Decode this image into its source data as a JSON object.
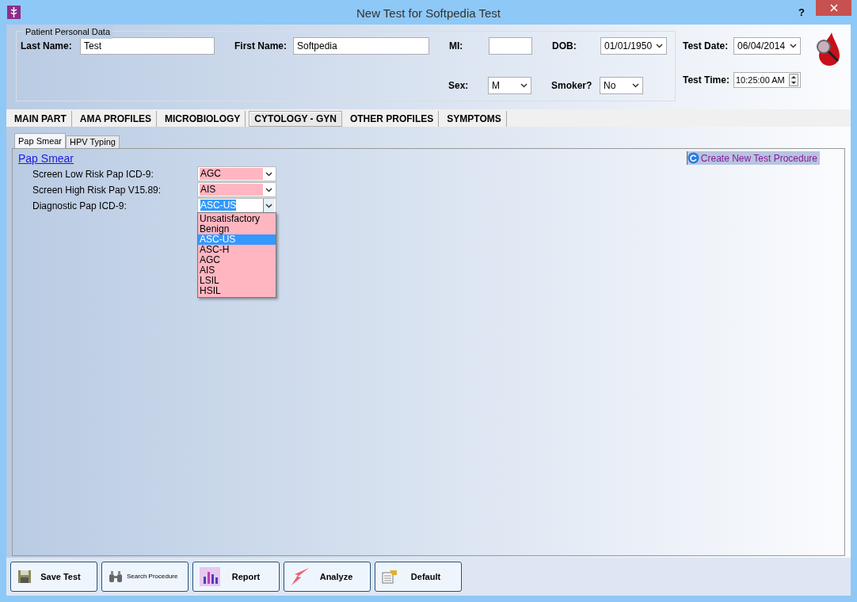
{
  "window": {
    "title": "New Test for Softpedia Test",
    "help": "?"
  },
  "patient": {
    "title": "Patient Personal Data",
    "row1": [
      {
        "label": "Last Name:",
        "value": "Test",
        "kind": "text"
      },
      {
        "label": "First Name:",
        "value": "Softpedia",
        "kind": "text"
      },
      {
        "label": "MI:",
        "kind": "text"
      },
      {
        "label": "DOB:",
        "value": "01/01/1950",
        "kind": "select"
      }
    ],
    "row2": [
      {
        "label": "Sex:",
        "value": "M",
        "kind": "select"
      },
      {
        "label": "Smoker?",
        "value": "No",
        "kind": "select"
      }
    ]
  },
  "test": {
    "date_label": "Test Date:",
    "date": "06/04/2014",
    "time_label": "Test Time:",
    "time": "10:25:00 AM"
  },
  "main_tabs": [
    {
      "label": "MAIN PART",
      "selected": false
    },
    {
      "label": "AMA PROFILES",
      "selected": false
    },
    {
      "label": "MICROBIOLOGY",
      "selected": false
    },
    {
      "label": "CYTOLOGY - GYN",
      "selected": true
    },
    {
      "label": "OTHER PROFILES",
      "selected": false
    },
    {
      "label": "SYMPTOMS",
      "selected": false
    }
  ],
  "sub_tabs": [
    {
      "label": "Pap Smear",
      "selected": true
    },
    {
      "label": "HPV Typing",
      "selected": false
    }
  ],
  "section_title": "Pap Smear",
  "create_link": "Create New Test Procedure",
  "pap_rows": [
    {
      "label": "Screen Low Risk Pap ICD-9:",
      "value": "AGC",
      "open": false
    },
    {
      "label": "Screen High Risk Pap V15.89:",
      "value": "AIS",
      "open": false
    },
    {
      "label": "Diagnostic Pap ICD-9:",
      "value": "ASC-US",
      "open": true
    }
  ],
  "options": [
    {
      "label": "Unsatisfactory",
      "selected": false
    },
    {
      "label": "Benign",
      "selected": false
    },
    {
      "label": "ASC-US",
      "selected": true
    },
    {
      "label": "ASC-H",
      "selected": false
    },
    {
      "label": "AGC",
      "selected": false
    },
    {
      "label": "AIS",
      "selected": false
    },
    {
      "label": "LSIL",
      "selected": false
    },
    {
      "label": "HSIL",
      "selected": false
    }
  ],
  "buttons": [
    {
      "label": "Save Test",
      "kind": "save"
    },
    {
      "label": "Search Procedure",
      "kind": "search"
    },
    {
      "label": "Report",
      "kind": "report"
    },
    {
      "label": "Analyze",
      "kind": "analyze"
    },
    {
      "label": "Default",
      "kind": "default"
    }
  ]
}
